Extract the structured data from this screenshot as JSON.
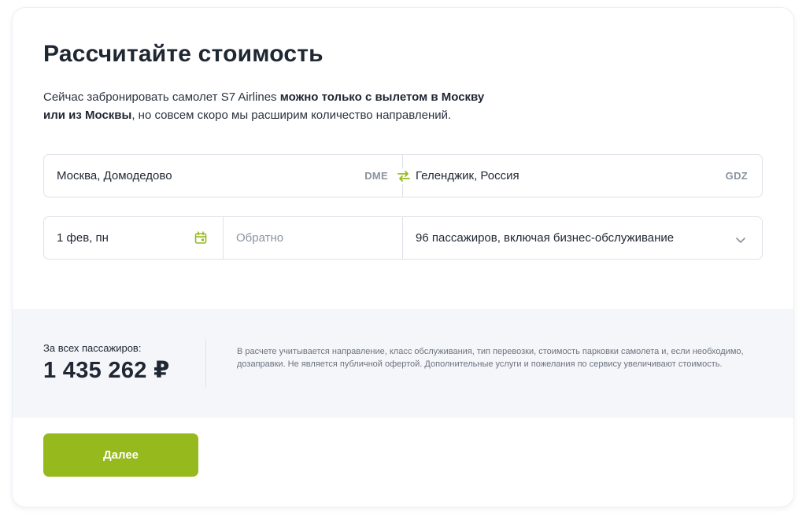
{
  "title": "Рассчитайте стоимость",
  "description": {
    "part1": "Сейчас забронировать самолет S7 Airlines ",
    "bold1": "можно только с вылетом в Москву",
    "bold2": "или из Москвы",
    "part2": ", но совсем скоро мы расширим количество направлений."
  },
  "route": {
    "from": {
      "city": "Москва, Домодедово",
      "code": "DME"
    },
    "to": {
      "city": "Геленджик, Россия",
      "code": "GDZ"
    },
    "swap_icon": "swap-arrows-icon"
  },
  "dates": {
    "departure": "1 фев, пн",
    "return_placeholder": "Обратно",
    "calendar_icon": "calendar-icon"
  },
  "passengers": {
    "value": "96 пассажиров, включая бизнес-обслуживание",
    "dropdown_icon": "chevron-down-icon"
  },
  "price": {
    "label": "За всех пассажиров:",
    "value": "1 435 262 ₽",
    "note": "В расчете учитывается направление, класс обслуживания, тип перевозки, стоимость парковки самолета и, если необходимо, дозаправки. Не является публичной офертой. Дополнительные услуги и пожелания по сервису увеличивают стоимость."
  },
  "next_button": {
    "label": "Далее"
  },
  "colors": {
    "accent": "#96b91d",
    "text": "#1f2733",
    "muted": "#8a93a0",
    "panel": "#f4f6f9"
  }
}
